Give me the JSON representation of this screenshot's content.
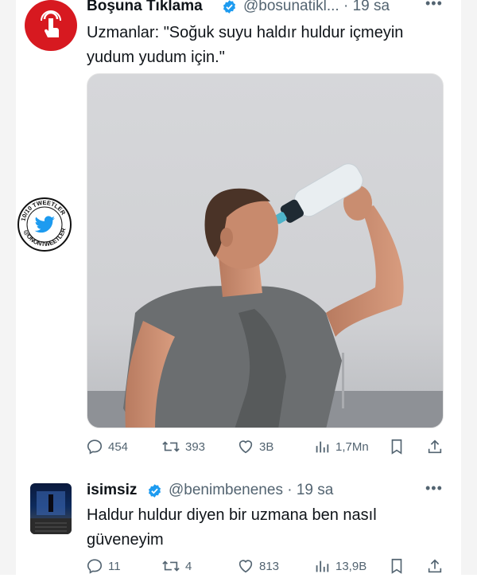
{
  "tweet1": {
    "display_name": "Boşuna Tıklama",
    "handle_time": "@bosunatikl... · 19 sa",
    "text_line1": "Uzmanlar: \"Soğuk suyu haldır huldur içmeyin",
    "text_line2": "yudum yudum için.\"",
    "replies": "454",
    "retweets": "393",
    "likes": "3B",
    "views": "1,7Mn"
  },
  "tweet2": {
    "display_name": "isimsiz",
    "handle_time": "@benimbenenes · 19 sa",
    "text_line1": "Haldur huldur diyen bir uzmana ben nasıl",
    "text_line2": "güveneyim",
    "replies": "11",
    "retweets": "4",
    "likes": "813",
    "views": "13,9B"
  },
  "watermark": {
    "top_text": "10/10 TWEETLER",
    "bottom_text": "@ONONTWEETLER"
  },
  "colors": {
    "verified": "#1d9bf0",
    "muted": "#536471",
    "brand_red": "#d71920"
  },
  "icons": [
    "reply-icon",
    "retweet-icon",
    "like-icon",
    "views-icon",
    "bookmark-icon",
    "share-icon",
    "verified-icon",
    "more-icon",
    "tap-icon",
    "twitter-bird-icon"
  ]
}
